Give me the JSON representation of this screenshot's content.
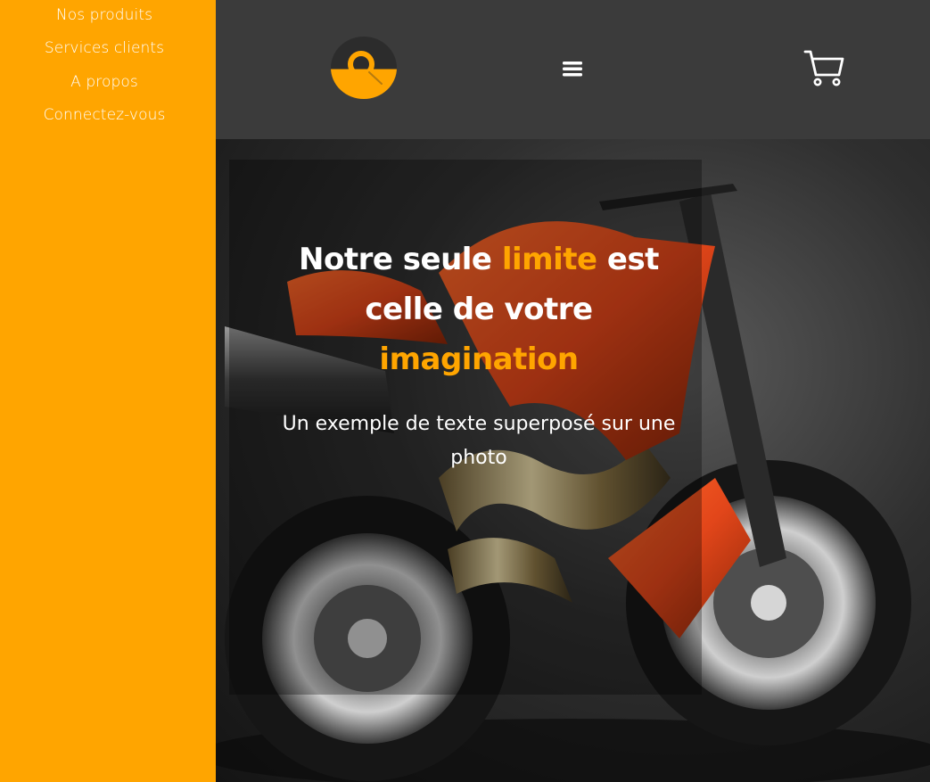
{
  "sidebar": {
    "items": [
      {
        "label": "Nos produits"
      },
      {
        "label": "Services clients"
      },
      {
        "label": "A propos"
      },
      {
        "label": "Connectez-vous"
      }
    ]
  },
  "header": {
    "logo_icon": "search-icon",
    "menu_icon": "hamburger-menu-icon",
    "cart_icon": "shopping-cart-icon"
  },
  "hero": {
    "title_part1": "Notre seule ",
    "title_accent1": "limite",
    "title_part2": " est celle de votre ",
    "title_accent2": "imagination",
    "subtitle": "Un exemple de texte superposé sur une photo",
    "background_image": "orange motorcycle on dark studio background"
  },
  "colors": {
    "accent": "#FFA500",
    "header_bg": "#3b3b3b",
    "text": "#ffffff"
  }
}
